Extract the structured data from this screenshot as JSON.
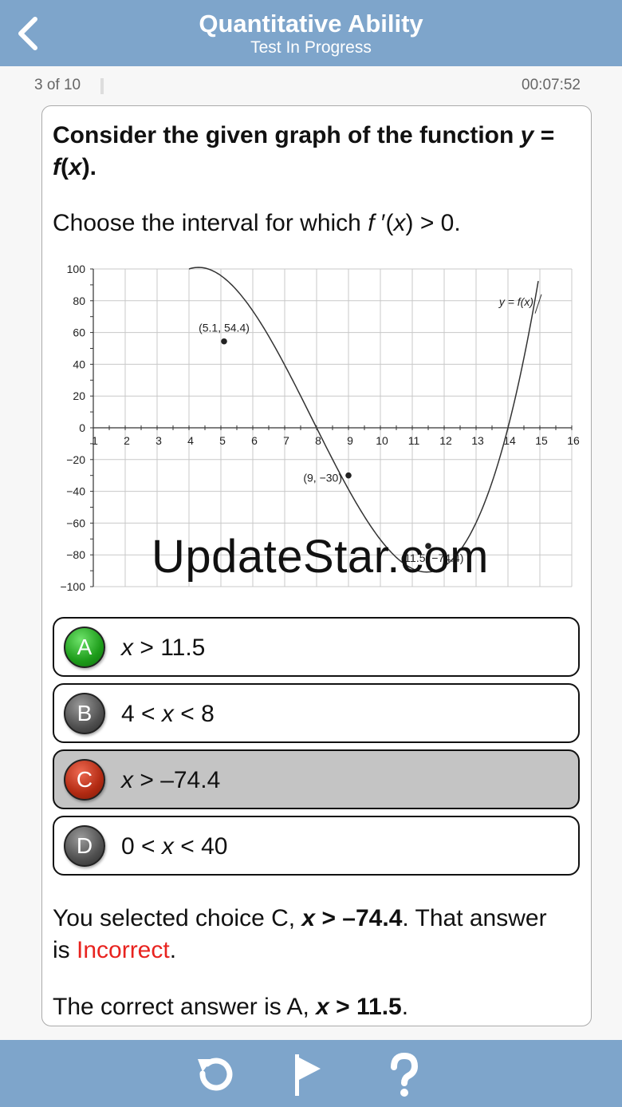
{
  "header": {
    "title": "Quantitative Ability",
    "subtitle": "Test In Progress",
    "back_icon": "chevron-left-icon"
  },
  "status": {
    "progress": "3 of 10",
    "timer": "00:07:52"
  },
  "question": {
    "title_part1": "Consider the given graph of the function ",
    "title_y": "y",
    "title_part2": " = ",
    "title_f": "f",
    "title_part3": "(",
    "title_x": "x",
    "title_part4": ").",
    "body_part1": "Choose the interval for which ",
    "body_f": "f ",
    "body_part2": "′(",
    "body_x": "x",
    "body_part3": ") > 0."
  },
  "chart_data": {
    "type": "line",
    "x_ticks": [
      "1",
      "2",
      "3",
      "4",
      "5",
      "6",
      "7",
      "8",
      "9",
      "10",
      "11",
      "12",
      "13",
      "14",
      "15",
      "16"
    ],
    "y_ticks": [
      "100",
      "80",
      "60",
      "40",
      "20",
      "0",
      "−20",
      "−40",
      "−60",
      "−80",
      "−100"
    ],
    "xlim": [
      1,
      16
    ],
    "ylim": [
      -100,
      100
    ],
    "grid": true,
    "series_label": "y = f(x)",
    "points": [
      {
        "x": 5.1,
        "y": 54.4,
        "label": "(5.1, 54.4)"
      },
      {
        "x": 9,
        "y": -30,
        "label": "(9, −30)"
      },
      {
        "x": 11.5,
        "y": -74.4,
        "label": "(11.5, −74.4)"
      }
    ]
  },
  "choices": [
    {
      "letter": "A",
      "var": "x",
      "rest": " > 11.5",
      "pre": "",
      "color": "#1d9c1a"
    },
    {
      "letter": "B",
      "pre": "4 < ",
      "var": "x",
      "rest": " < 8",
      "color": "#505050"
    },
    {
      "letter": "C",
      "var": "x",
      "rest": " > –74.4",
      "pre": "",
      "color": "#b22a12"
    },
    {
      "letter": "D",
      "pre": "0 < ",
      "var": "x",
      "rest": " < 40",
      "color": "#505050"
    }
  ],
  "feedback": {
    "part1": "You selected choice C, ",
    "answer_x": "x",
    "answer_rest": " > –74.4",
    "part2": ". That answer is ",
    "result": "Incorrect",
    "part3": "."
  },
  "correct": {
    "part1": "The correct answer is A, ",
    "answer_x": "x",
    "answer_rest": " > 11.5",
    "part2": "."
  },
  "footer": {
    "icons": [
      "refresh-icon",
      "flag-icon",
      "help-icon"
    ]
  },
  "watermark": "UpdateStar.com"
}
